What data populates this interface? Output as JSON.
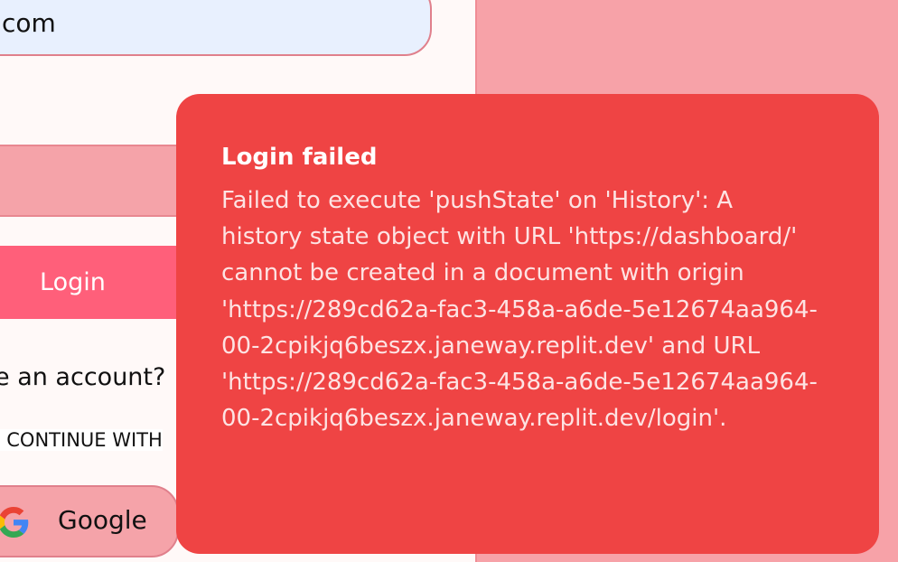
{
  "login_form": {
    "email_value": "com",
    "login_label": "Login",
    "signup_prompt": "e an account?",
    "divider_text": "R CONTINUE WITH",
    "google_label": "Google"
  },
  "toast": {
    "title": "Login failed",
    "message": "Failed to execute 'pushState' on 'History': A history state object with URL 'https://dashboard/' cannot be created in a document with origin 'https://289cd62a-fac3-458a-a6de-5e12674aa964-00-2cpikjq6beszx.janeway.replit.dev' and URL 'https://289cd62a-fac3-458a-a6de-5e12674aa964-00-2cpikjq6beszx.janeway.replit.dev/login'."
  },
  "colors": {
    "toast_background": "#ef4444",
    "accent": "#ff5f7a",
    "page_background": "#f7a2a8"
  },
  "icons": {
    "google": "google-g-icon"
  }
}
